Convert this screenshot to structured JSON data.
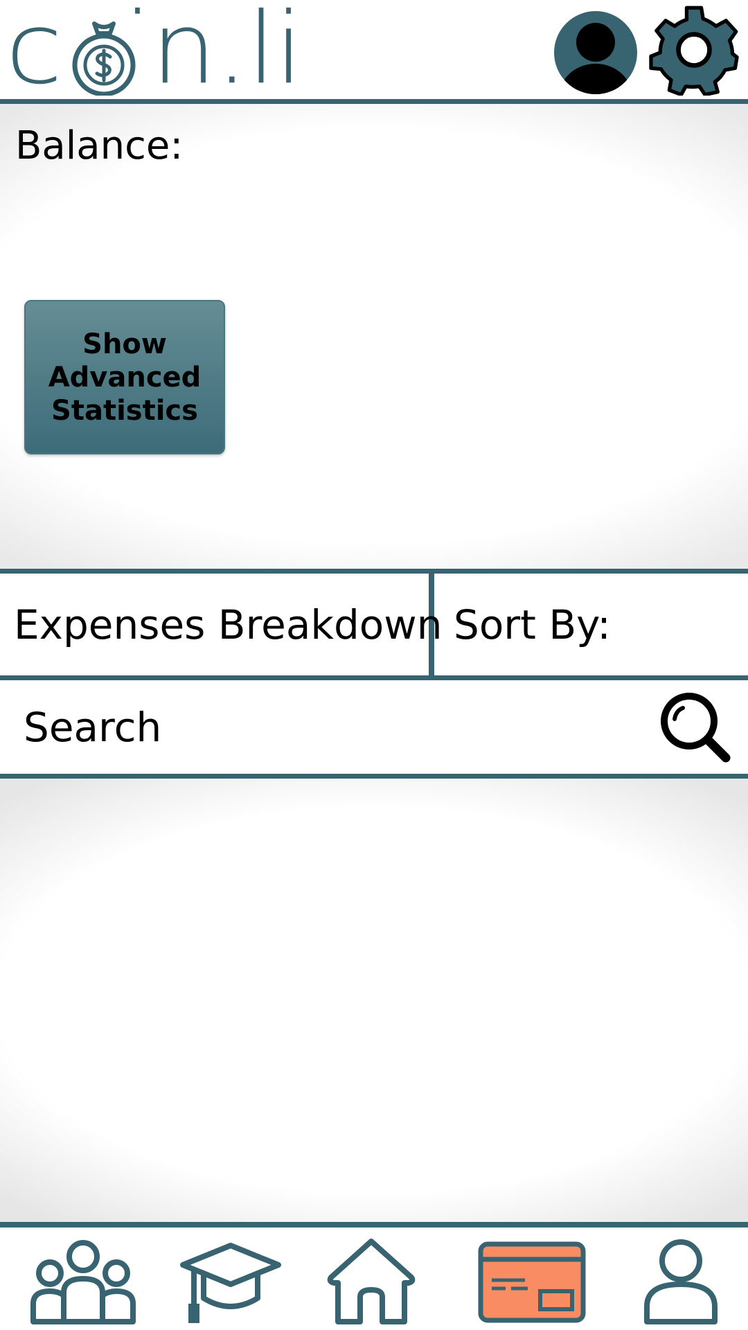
{
  "app": {
    "logo_text": "coin.li",
    "brand_color": "#386471",
    "accent_color": "#f98c63"
  },
  "header": {
    "avatar_icon": "user-avatar-icon",
    "settings_icon": "gear-icon"
  },
  "balance": {
    "label": "Balance:",
    "advanced_button_label": "Show Advanced Statistics"
  },
  "tabs": {
    "expenses_label": "Expenses Breakdown",
    "sort_label": "Sort By:"
  },
  "search": {
    "placeholder": "Search",
    "icon": "search-icon"
  },
  "nav": {
    "items": [
      {
        "name": "groups",
        "icon": "people-icon",
        "active": false
      },
      {
        "name": "learn",
        "icon": "graduation-cap-icon",
        "active": false
      },
      {
        "name": "home",
        "icon": "home-icon",
        "active": false
      },
      {
        "name": "expenses",
        "icon": "credit-card-icon",
        "active": true
      },
      {
        "name": "profile",
        "icon": "user-icon",
        "active": false
      }
    ]
  }
}
